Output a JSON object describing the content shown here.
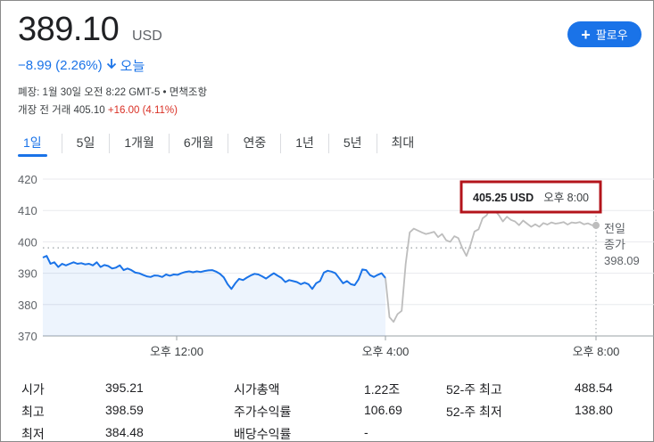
{
  "quote": {
    "price": "389.10",
    "currency": "USD",
    "change": "−8.99 (2.26%)",
    "change_period": "오늘",
    "meta_line1": "폐장: 1월 30일 오전 8:22 GMT-5 • 면책조항",
    "premarket_prefix": "개장 전 거래 405.10",
    "premarket_change": "+16.00 (4.11%)"
  },
  "follow_button": {
    "label": "팔로우"
  },
  "tabs": [
    "1일",
    "5일",
    "1개월",
    "6개월",
    "연중",
    "1년",
    "5년",
    "최대"
  ],
  "colors": {
    "accent": "#1a73e8",
    "up": "#d93025",
    "highlight_box": "#b3141b",
    "afterhours_line": "#bdbdbd"
  },
  "chart_data": {
    "type": "line",
    "ylim": [
      370,
      420
    ],
    "yticks": [
      "420",
      "410",
      "400",
      "390",
      "380",
      "370"
    ],
    "xticks": [
      "오후 12:00",
      "오후 4:00",
      "오후 8:00"
    ],
    "grid": true,
    "tooltip": {
      "value": "405.25 USD",
      "time": "오후 8:00"
    },
    "previous_close": {
      "label_line1": "전일",
      "label_line2": "종가",
      "value": "398.09",
      "y": 398.09
    },
    "series": [
      {
        "segment": "regular",
        "y": [
          395,
          395.5,
          393,
          393.5,
          392,
          393,
          392.5,
          393,
          393.5,
          393,
          393.2,
          392.8,
          393,
          392.5,
          393.5,
          392,
          392.6,
          392.3,
          391.5,
          391.8,
          392.5,
          391,
          391.5,
          391,
          390.2,
          390,
          389.5,
          389,
          388.8,
          389.3,
          389.2,
          388.8,
          389.6,
          389.2,
          389.6,
          389.5,
          390,
          390.4,
          390.6,
          390.3,
          390.6,
          390.4,
          390.7,
          390.9,
          391,
          390.5,
          389.8,
          388.7,
          386.5,
          385,
          386.8,
          388.2,
          387.8,
          388.6,
          389.3,
          389.8,
          389.6,
          389,
          388.3,
          389.2,
          390,
          389.2,
          388.5,
          387.2,
          387.8,
          387.5,
          387.2,
          386.5,
          387,
          386.5,
          385,
          386.8,
          387.5,
          390.2,
          390.8,
          390.5,
          390,
          388.4,
          386.8,
          387.5,
          386.5,
          386.2,
          388,
          391.2,
          391,
          389.4,
          388.8,
          389.5,
          390,
          388.5
        ]
      },
      {
        "segment": "extended",
        "y": [
          388.5,
          376,
          374.5,
          377,
          378,
          393,
          403,
          404.2,
          403.6,
          403,
          402.5,
          402.8,
          403.2,
          401.5,
          402.5,
          400.5,
          400,
          401.8,
          401.2,
          398,
          395.5,
          399,
          403.3,
          404,
          407.5,
          408.5,
          411,
          410,
          408.5,
          406.5,
          408,
          407,
          406.5,
          405.3,
          406.8,
          405.8,
          404.8,
          405.6,
          404.8,
          406,
          405.5,
          406.2,
          405.8,
          406,
          406.3,
          405.5,
          406.2,
          406,
          406.3,
          405.6,
          405.9,
          405.3,
          405.25
        ]
      }
    ]
  },
  "stats": [
    {
      "label": "시가",
      "value": "395.21"
    },
    {
      "label": "최고",
      "value": "398.59"
    },
    {
      "label": "최저",
      "value": "384.48"
    },
    {
      "label": "시가총액",
      "value": "1.22조"
    },
    {
      "label": "주가수익률",
      "value": "106.69"
    },
    {
      "label": "배당수익률",
      "value": "-"
    },
    {
      "label": "52-주 최고",
      "value": "488.54"
    },
    {
      "label": "52-주 최저",
      "value": "138.80"
    }
  ]
}
